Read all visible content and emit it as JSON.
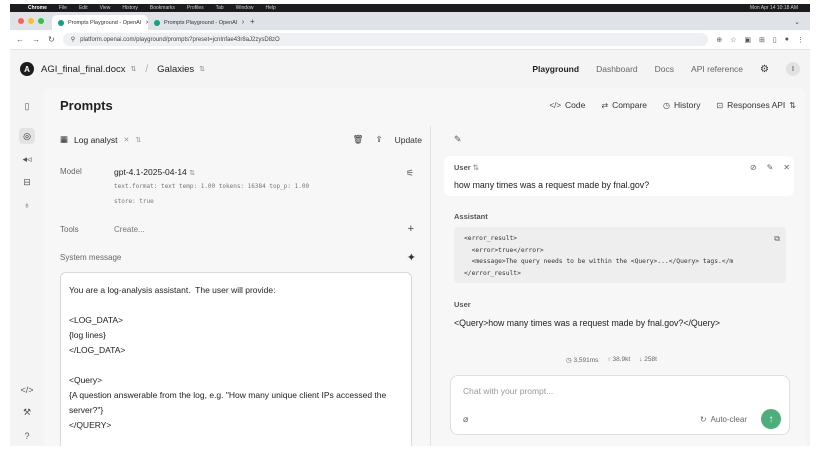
{
  "menubar": {
    "app": "Chrome",
    "items": [
      "File",
      "Edit",
      "View",
      "History",
      "Bookmarks",
      "Profiles",
      "Tab",
      "Window",
      "Help"
    ],
    "clock": "Mon Apr 14  10:18 AM"
  },
  "tabs": [
    {
      "title": "Prompts Playground - OpenAI",
      "active": true
    },
    {
      "title": "Prompts Playground - OpenAI",
      "active": false
    }
  ],
  "address": {
    "url": "platform.openai.com/playground/prompts?preset=jcnInfae43r8aJ2zysD8zO"
  },
  "header": {
    "avatar_letter": "A",
    "workspace": "AGI_final_final.docx",
    "project": "Galaxies",
    "nav": {
      "playground": "Playground",
      "dashboard": "Dashboard",
      "docs": "Docs",
      "api_reference": "API reference"
    },
    "user_initial": "I"
  },
  "main": {
    "title": "Prompts",
    "toolbar": {
      "code": "Code",
      "compare": "Compare",
      "history": "History",
      "responses_api": "Responses API"
    }
  },
  "left": {
    "preset_name": "Log analyst",
    "update_label": "Update",
    "model_label": "Model",
    "model_name": "gpt-4.1-2025-04-14",
    "model_params_line1": "text.format: text  temp: 1.00  tokens: 16384  top_p: 1.00",
    "model_params_line2": "store: true",
    "tools_label": "Tools",
    "tools_create": "Create...",
    "system_label": "System message",
    "system_message": "You are a log-analysis assistant.  The user will provide:\n\n<LOG_DATA>\n{log lines}\n</LOG_DATA>\n\n<Query>\n{A question answerable from the log, e.g. \"How many unique client IPs accessed the server?\"}\n</QUERY>"
  },
  "right": {
    "user_role": "User",
    "user_message": "how many times was a request made by fnal.gov?",
    "assistant_role": "Assistant",
    "assistant_code": "<error_result>\n  <error>true</error>\n  <message>The query needs to be within the <Query>...</Query> tags.</m\n</error_result>",
    "user2_role": "User",
    "user2_message": "<Query>how many times was a request made by fnal.gov?</Query>",
    "stats": {
      "time": "3,591ms",
      "in_tokens": "38.9kt",
      "out_tokens": "258t"
    },
    "composer_placeholder": "Chat with your prompt...",
    "auto_clear": "Auto-clear"
  },
  "colors": {
    "send_button": "#4caf7a",
    "favicon": "#10a37f"
  }
}
